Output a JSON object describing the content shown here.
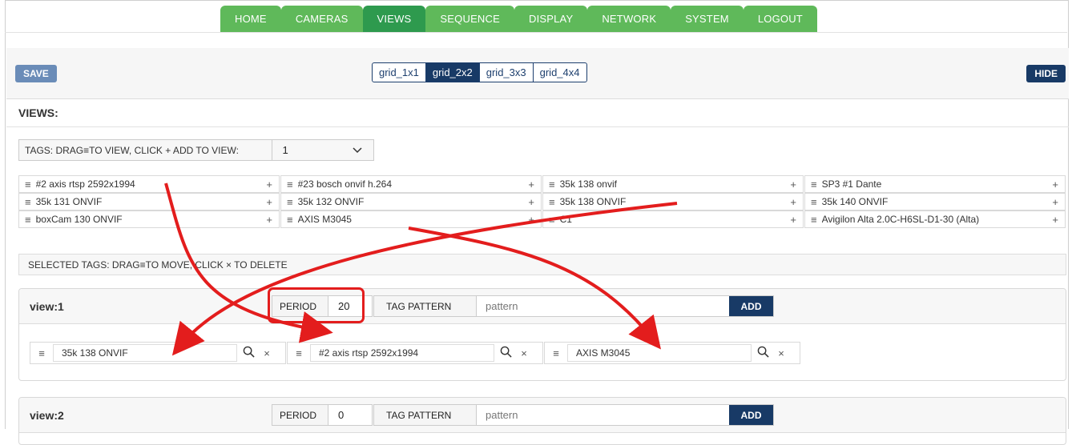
{
  "nav": {
    "tabs": [
      {
        "label": "HOME",
        "active": false
      },
      {
        "label": "CAMERAS",
        "active": false
      },
      {
        "label": "VIEWS",
        "active": true
      },
      {
        "label": "SEQUENCE",
        "active": false
      },
      {
        "label": "DISPLAY",
        "active": false
      },
      {
        "label": "NETWORK",
        "active": false
      },
      {
        "label": "SYSTEM",
        "active": false
      },
      {
        "label": "LOGOUT",
        "active": false
      }
    ]
  },
  "toolbar": {
    "save_label": "SAVE",
    "hide_label": "HIDE",
    "grid_options": [
      "grid_1x1",
      "grid_2x2",
      "grid_3x3",
      "grid_4x4"
    ],
    "grid_selected": "grid_2x2"
  },
  "views_title": "VIEWS:",
  "tags_header": {
    "label": "TAGS: DRAG≡TO VIEW, CLICK + ADD TO VIEW:",
    "select_value": "1"
  },
  "tags": [
    "#2 axis rtsp 2592x1994",
    "#23 bosch onvif h.264",
    "35k 138 onvif",
    "SP3 #1 Dante",
    "35k 131 ONVIF",
    "35k 132 ONVIF",
    "35k 138 ONVIF",
    "35k 140 ONVIF",
    "boxCam 130 ONVIF",
    "AXIS M3045",
    "C1",
    "Avigilon Alta 2.0C-H6SL-D1-30 (Alta)"
  ],
  "selected_header": "SELECTED TAGS: DRAG≡TO MOVE, CLICK × TO DELETE",
  "views": [
    {
      "name": "view:1",
      "period_label": "PERIOD",
      "period_value": "20",
      "tag_pattern_label": "TAG PATTERN",
      "tag_pattern_placeholder": "pattern",
      "add_label": "ADD",
      "selected_tags": [
        "35k 138 ONVIF",
        "#2 axis rtsp 2592x1994",
        "AXIS M3045"
      ]
    },
    {
      "name": "view:2",
      "period_label": "PERIOD",
      "period_value": "0",
      "tag_pattern_label": "TAG PATTERN",
      "tag_pattern_placeholder": "pattern",
      "add_label": "ADD",
      "selected_tags": []
    }
  ],
  "annotation_color": "#e31d1d"
}
